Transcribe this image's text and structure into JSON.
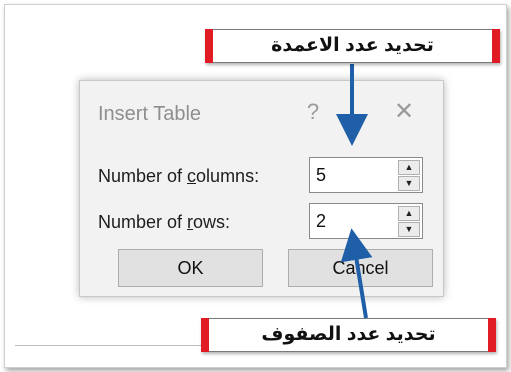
{
  "dialog": {
    "title": "Insert Table",
    "help_label": "?",
    "close_label": "✕",
    "columns": {
      "label_prefix": "Number of ",
      "label_access_key": "c",
      "label_suffix": "olumns:",
      "value": "5"
    },
    "rows": {
      "label_prefix": "Number of ",
      "label_access_key": "r",
      "label_suffix": "ows:",
      "value": "2"
    },
    "ok_label": "OK",
    "cancel_label": "Cancel"
  },
  "spinner": {
    "up_glyph": "▲",
    "down_glyph": "▼"
  },
  "annotations": {
    "columns_callout": "تحديد عدد الاعمدة",
    "rows_callout": "تحديد عدد الصفوف"
  },
  "colors": {
    "banner_accent": "#e01b24",
    "arrow": "#1f5fa8",
    "dialog_background": "#f2f2f2"
  }
}
